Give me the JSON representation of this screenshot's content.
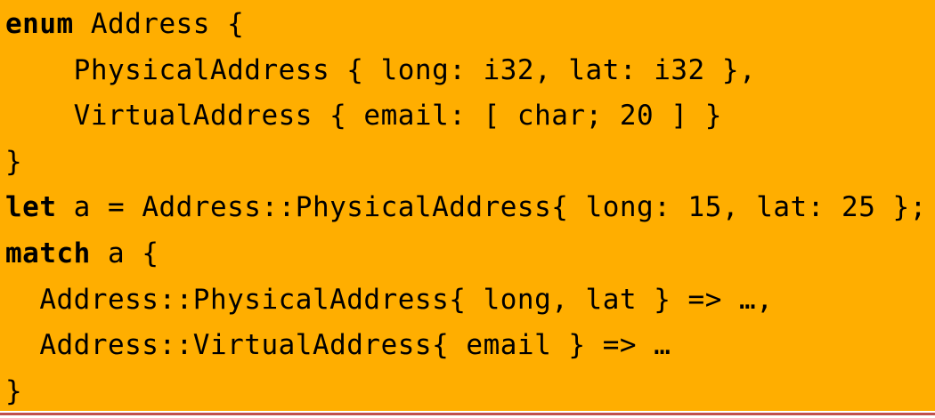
{
  "code": {
    "lines": [
      {
        "kw": "enum",
        "rest": " Address {"
      },
      {
        "kw": "",
        "rest": "    PhysicalAddress { long: i32, lat: i32 },"
      },
      {
        "kw": "",
        "rest": "    VirtualAddress { email: [ char; 20 ] }"
      },
      {
        "kw": "",
        "rest": "}"
      },
      {
        "kw": "let",
        "rest": " a = Address::PhysicalAddress{ long: 15, lat: 25 };"
      },
      {
        "kw": "match",
        "rest": " a {"
      },
      {
        "kw": "",
        "rest": "  Address::PhysicalAddress{ long, lat } => …,"
      },
      {
        "kw": "",
        "rest": "  Address::VirtualAddress{ email } => …"
      },
      {
        "kw": "",
        "rest": "}"
      }
    ]
  },
  "colors": {
    "background": "#FFAE00",
    "text": "#000000",
    "rule": "#C0504D"
  }
}
